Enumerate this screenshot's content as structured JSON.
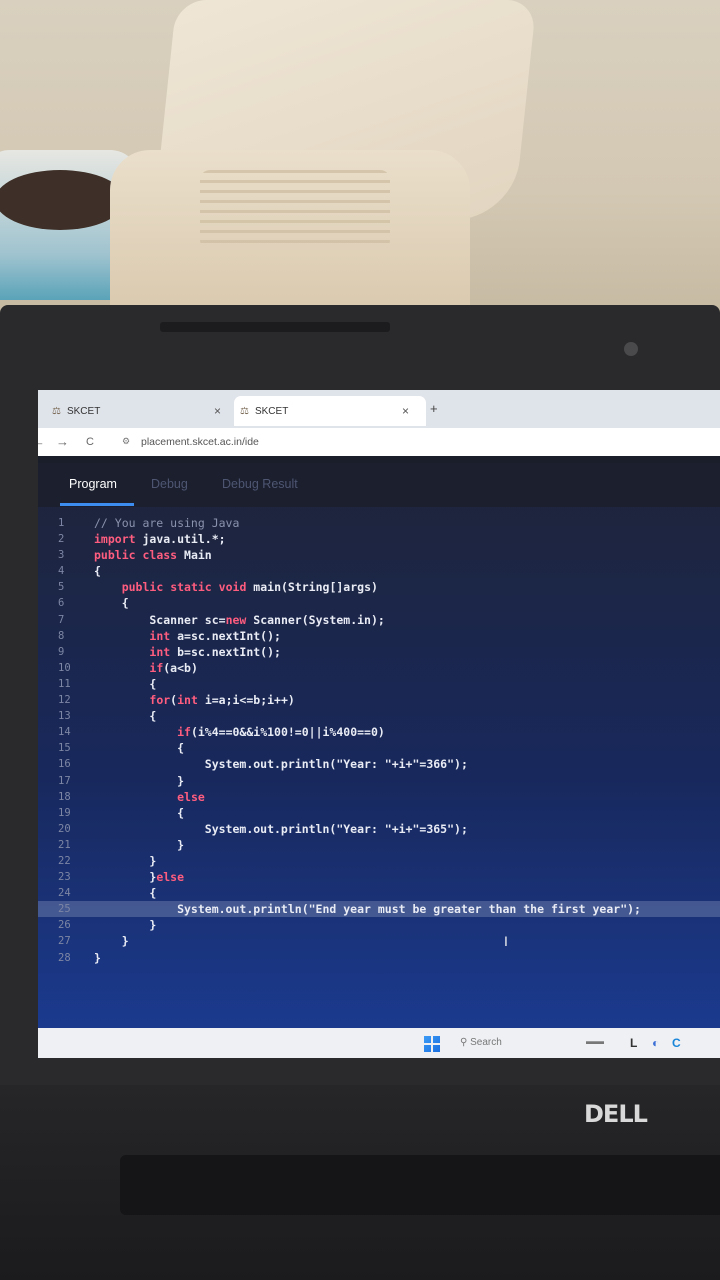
{
  "browser": {
    "tabs": [
      {
        "title": "SKCET",
        "close": "×"
      },
      {
        "title": "SKCET",
        "close": "×"
      }
    ],
    "new_tab": "+",
    "url": "placement.skcet.ac.in/ide",
    "nav": {
      "back": "←",
      "forward": "→",
      "reload": "C"
    }
  },
  "ide": {
    "tabs": [
      "Program",
      "Debug",
      "Debug Result"
    ],
    "active_tab": "Program",
    "code_lines": [
      {
        "n": "1",
        "text": "// You are using Java"
      },
      {
        "n": "2",
        "text": "import java.util.*;"
      },
      {
        "n": "3",
        "text": "public class Main"
      },
      {
        "n": "4",
        "text": "{"
      },
      {
        "n": "5",
        "text": "    public static void main(String[]args)"
      },
      {
        "n": "6",
        "text": "    {"
      },
      {
        "n": "7",
        "text": "        Scanner sc=new Scanner(System.in);"
      },
      {
        "n": "8",
        "text": "        int a=sc.nextInt();"
      },
      {
        "n": "9",
        "text": "        int b=sc.nextInt();"
      },
      {
        "n": "10",
        "text": "        if(a<b)"
      },
      {
        "n": "11",
        "text": "        {"
      },
      {
        "n": "12",
        "text": "        for(int i=a;i<=b;i++)"
      },
      {
        "n": "13",
        "text": "        {"
      },
      {
        "n": "14",
        "text": "            if(i%4==0&&i%100!=0||i%400==0)"
      },
      {
        "n": "15",
        "text": "            {"
      },
      {
        "n": "16",
        "text": "                System.out.println(\"Year: \"+i+\"=366\");"
      },
      {
        "n": "17",
        "text": "            }"
      },
      {
        "n": "18",
        "text": "            else"
      },
      {
        "n": "19",
        "text": "            {"
      },
      {
        "n": "20",
        "text": "                System.out.println(\"Year: \"+i+\"=365\");"
      },
      {
        "n": "21",
        "text": "            }"
      },
      {
        "n": "22",
        "text": "        }"
      },
      {
        "n": "23",
        "text": "        }else"
      },
      {
        "n": "24",
        "text": "        {"
      },
      {
        "n": "25",
        "text": "            System.out.println(\"End year must be greater than the first year\");"
      },
      {
        "n": "26",
        "text": "        }"
      },
      {
        "n": "27",
        "text": "    }"
      },
      {
        "n": "28",
        "text": "}"
      }
    ],
    "highlighted_line": "25"
  },
  "taskbar": {
    "search_placeholder": "Search"
  },
  "laptop_brand": "DELL",
  "colors": {
    "editor_bg": "#18285c",
    "keyword": "#ff5d7f",
    "active_tab_underline": "#3d8cf0"
  }
}
